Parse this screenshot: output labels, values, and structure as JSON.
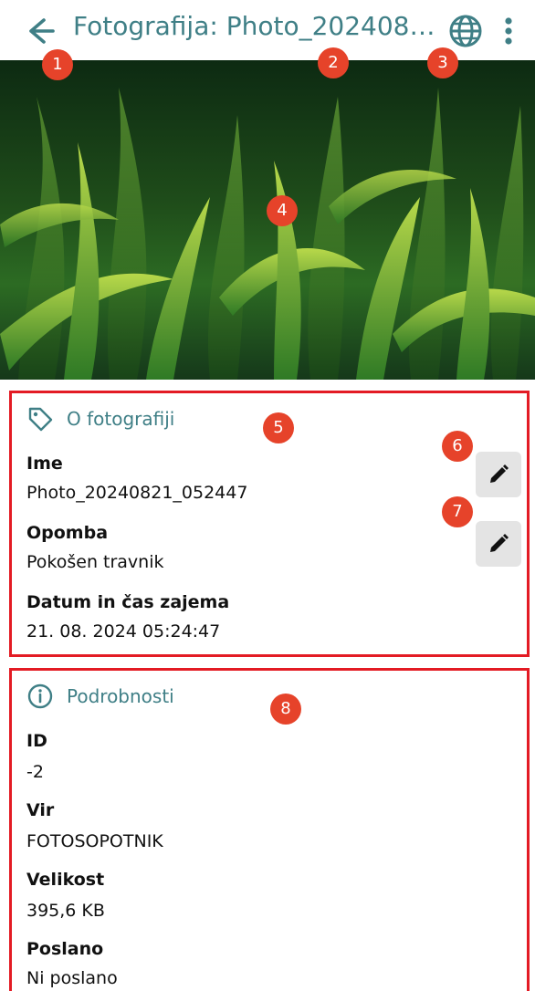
{
  "header": {
    "title": "Fotografija: Photo_2024082...",
    "icons": [
      "back-arrow-icon",
      "globe-icon",
      "more-vert-icon"
    ]
  },
  "badges": [
    "1",
    "2",
    "3",
    "4",
    "5",
    "6",
    "7",
    "8"
  ],
  "about": {
    "title": "O fotografiji",
    "fields": [
      {
        "label": "Ime",
        "value": "Photo_20240821_052447"
      },
      {
        "label": "Opomba",
        "value": "Pokošen travnik"
      },
      {
        "label": "Datum in čas zajema",
        "value": "21. 08. 2024 05:24:47"
      }
    ]
  },
  "details": {
    "title": "Podrobnosti",
    "fields": [
      {
        "label": "ID",
        "value": "-2"
      },
      {
        "label": "Vir",
        "value": "FOTOSOPOTNIK"
      },
      {
        "label": "Velikost",
        "value": "395,6 KB"
      },
      {
        "label": "Poslano",
        "value": "Ni poslano"
      }
    ]
  },
  "colors": {
    "accent": "#3f7f86",
    "highlight": "#e31b24",
    "badge": "#e6432a"
  }
}
